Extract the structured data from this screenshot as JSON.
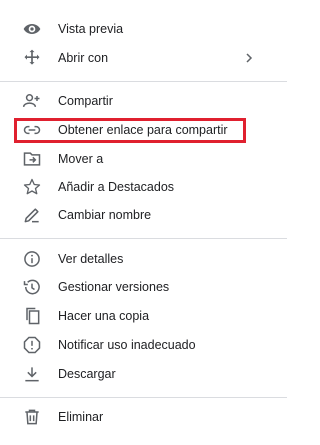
{
  "menu": {
    "items": [
      {
        "label": "Vista previa",
        "icon": "eye-icon"
      },
      {
        "label": "Abrir con",
        "icon": "move-arrows-icon",
        "submenu": true
      },
      {
        "label": "Compartir",
        "icon": "person-add-icon"
      },
      {
        "label": "Obtener enlace para compartir",
        "icon": "link-icon",
        "highlighted": true
      },
      {
        "label": "Mover a",
        "icon": "folder-move-icon"
      },
      {
        "label": "Añadir a Destacados",
        "icon": "star-icon"
      },
      {
        "label": "Cambiar nombre",
        "icon": "pencil-icon"
      },
      {
        "label": "Ver detalles",
        "icon": "info-icon"
      },
      {
        "label": "Gestionar versiones",
        "icon": "history-icon"
      },
      {
        "label": "Hacer una copia",
        "icon": "copy-icon"
      },
      {
        "label": "Notificar uso inadecuado",
        "icon": "report-icon"
      },
      {
        "label": "Descargar",
        "icon": "download-icon"
      },
      {
        "label": "Eliminar",
        "icon": "trash-icon"
      }
    ]
  },
  "colors": {
    "highlight_border": "#e0202f",
    "icon": "#5f6368",
    "text": "#202124",
    "divider": "#dadce0"
  }
}
